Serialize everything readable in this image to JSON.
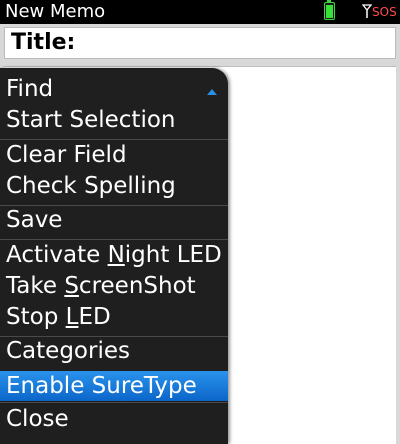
{
  "status_bar": {
    "title": "New Memo",
    "signal_text": "SOS",
    "battery_color": "#39e039",
    "sos_color": "#ff4a4a"
  },
  "memo": {
    "title_label": "Title:"
  },
  "menu": {
    "items": [
      {
        "label": "Find"
      },
      {
        "label": "Start Selection"
      },
      {
        "label": "Clear Field"
      },
      {
        "label": "Check Spelling"
      },
      {
        "label": "Save"
      },
      {
        "label_pre": "Activate ",
        "label_u": "N",
        "label_post": "ight LED"
      },
      {
        "label_pre": "Take ",
        "label_u": "S",
        "label_post": "creenShot"
      },
      {
        "label_pre": "Stop ",
        "label_u": "L",
        "label_post": "ED"
      },
      {
        "label": "Categories"
      },
      {
        "label": "Enable SureType",
        "selected": true
      },
      {
        "label": "Close"
      }
    ],
    "highlight_color": "#1a7fdc"
  }
}
